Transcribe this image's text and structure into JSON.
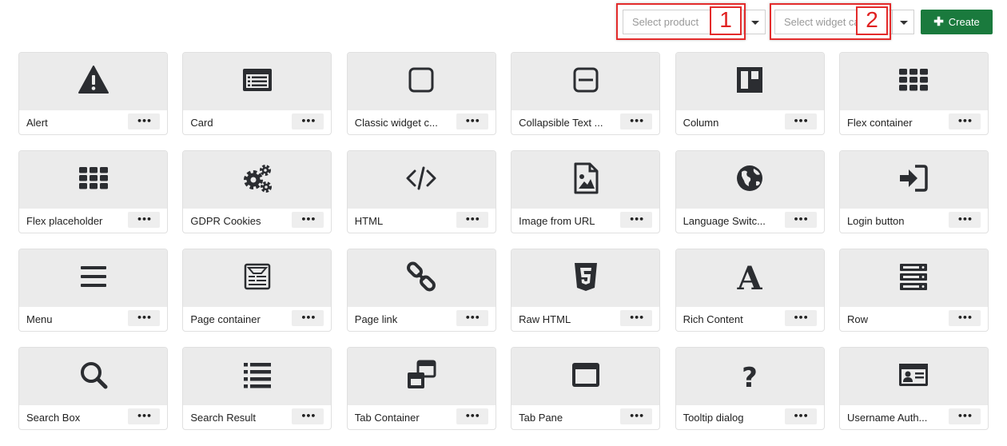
{
  "toolbar": {
    "product_select": {
      "placeholder": "Select product"
    },
    "category_select": {
      "placeholder": "Select widget cat"
    },
    "create_label": "Create",
    "callouts": [
      {
        "number": "1",
        "color": "#e32b2b"
      },
      {
        "number": "2",
        "color": "#e32b2b"
      }
    ],
    "create_color": "#1a7a3d"
  },
  "widgets": [
    {
      "label": "Alert",
      "icon": "alert-icon"
    },
    {
      "label": "Card",
      "icon": "card-icon"
    },
    {
      "label": "Classic widget c...",
      "icon": "square-outline-icon"
    },
    {
      "label": "Collapsible Text ...",
      "icon": "collapse-square-icon"
    },
    {
      "label": "Column",
      "icon": "columns-icon"
    },
    {
      "label": "Flex container",
      "icon": "grid-dots-icon"
    },
    {
      "label": "Flex placeholder",
      "icon": "grid-dots-icon"
    },
    {
      "label": "GDPR Cookies",
      "icon": "cogs-icon"
    },
    {
      "label": "HTML",
      "icon": "code-icon"
    },
    {
      "label": "Image from URL",
      "icon": "file-image-icon"
    },
    {
      "label": "Language Switc...",
      "icon": "globe-icon"
    },
    {
      "label": "Login button",
      "icon": "sign-in-icon"
    },
    {
      "label": "Menu",
      "icon": "bars-icon"
    },
    {
      "label": "Page container",
      "icon": "newspaper-icon"
    },
    {
      "label": "Page link",
      "icon": "link-icon"
    },
    {
      "label": "Raw HTML",
      "icon": "html5-icon"
    },
    {
      "label": "Rich Content",
      "icon": "font-icon"
    },
    {
      "label": "Row",
      "icon": "server-icon"
    },
    {
      "label": "Search Box",
      "icon": "search-icon"
    },
    {
      "label": "Search Result",
      "icon": "list-icon"
    },
    {
      "label": "Tab Container",
      "icon": "clone-icon"
    },
    {
      "label": "Tab Pane",
      "icon": "window-icon"
    },
    {
      "label": "Tooltip dialog",
      "icon": "question-icon"
    },
    {
      "label": "Username Auth...",
      "icon": "id-card-icon"
    }
  ],
  "more_label": "•••"
}
